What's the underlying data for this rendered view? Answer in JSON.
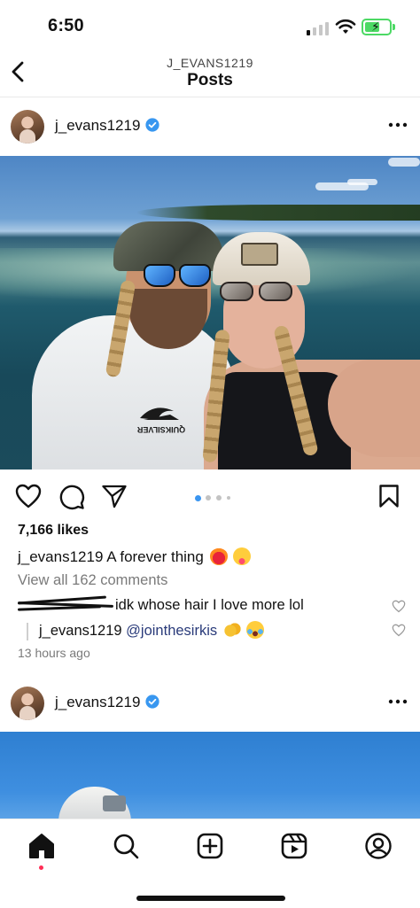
{
  "status_bar": {
    "time": "6:50",
    "signal_bars_filled": 1,
    "signal_bars_total": 4,
    "battery_level": 0.6,
    "battery_charging": true,
    "icons": [
      "signal-icon",
      "wifi-icon",
      "battery-icon"
    ]
  },
  "header": {
    "subtitle": "J_EVANS1219",
    "title": "Posts",
    "back_icon": "chevron-left-icon"
  },
  "post1": {
    "username": "j_evans1219",
    "verified": true,
    "likes": "7,166 likes",
    "caption_user": "j_evans1219",
    "caption_text": "A forever thing",
    "caption_emojis": [
      "heart-on-fire-emoji",
      "squinting-tongue-emoji"
    ],
    "view_comments": "View all 162 comments",
    "comments": [
      {
        "user_redacted": true,
        "text": "idk whose hair I love more lol"
      },
      {
        "user": "j_evans1219",
        "mention": "@jointhesirkis",
        "emojis": [
          "clapping-hands-emoji",
          "tears-of-joy-emoji"
        ],
        "is_reply": true
      }
    ],
    "timestamp": "13 hours ago",
    "carousel_count": 4,
    "carousel_active": 0,
    "photo_text": "QUIKSILVER"
  },
  "post2": {
    "username": "j_evans1219",
    "verified": true
  },
  "tabbar": {
    "tabs": [
      "home-icon",
      "search-icon",
      "create-icon",
      "reels-icon",
      "profile-icon"
    ],
    "active": "home-icon"
  },
  "colors": {
    "verified_blue": "#3897f0",
    "mention": "#2a3b7a",
    "notification_dot": "#ff2d55",
    "battery_green": "#4cd964"
  }
}
